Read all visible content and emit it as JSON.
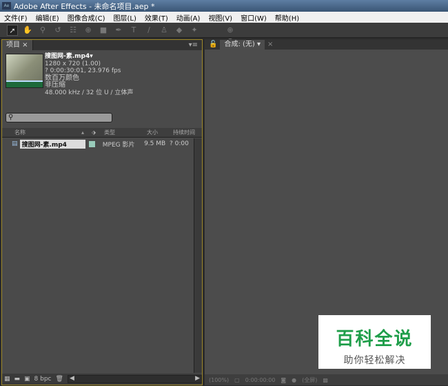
{
  "window": {
    "title": "Adobe After Effects - 未命名项目.aep *",
    "logo": "Ae"
  },
  "menu": [
    "文件(F)",
    "编辑(E)",
    "图像合成(C)",
    "图层(L)",
    "效果(T)",
    "动画(A)",
    "视图(V)",
    "窗口(W)",
    "帮助(H)"
  ],
  "tools": [
    "selection-icon",
    "hand-icon",
    "zoom-icon",
    "rotate-icon",
    "camera-icon",
    "pan-icon",
    "rectangle-icon",
    "pen-icon",
    "text-icon",
    "brush-icon",
    "stamp-icon",
    "eraser-icon",
    "puppet-icon",
    "axis-icon"
  ],
  "project": {
    "tab": "项目",
    "file_name": "搜图网-素.mp4▾",
    "resolution": "1280 x 720 (1.00)",
    "duration": "? 0:00:30:01, 23.976 fps",
    "colors": "数百万颜色",
    "compression": "非压缩",
    "audio": "48.000 kHz / 32 位 U / 立体声",
    "search_placeholder": "",
    "columns": {
      "name": "名称",
      "type": "类型",
      "size": "大小",
      "duration": "持续时间"
    },
    "items": [
      {
        "name": "搜图网-素.mp4",
        "type": "MPEG 影片",
        "size": "9.5 MB",
        "duration": "? 0:00"
      }
    ],
    "bpc": "8 bpc"
  },
  "composition": {
    "tab": "合成: (无)",
    "zoom": "(100%)",
    "time": "0:00:00:00",
    "view": "(全屏)"
  },
  "watermark": {
    "line1": "百科全说",
    "line2": "助你轻松解决"
  }
}
